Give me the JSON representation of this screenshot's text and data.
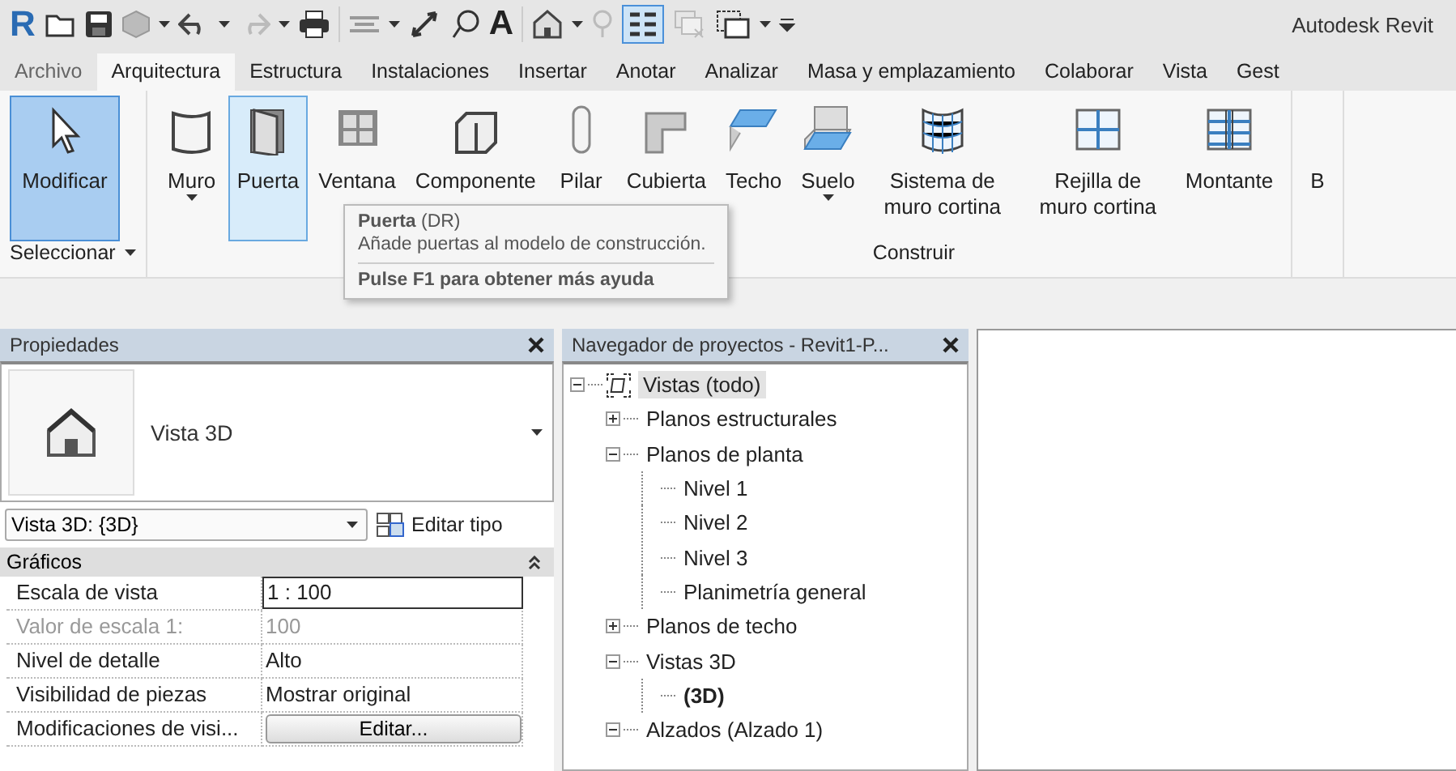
{
  "quick_access": {
    "logo": "R",
    "text_tool": "A",
    "title": "Autodesk Revit"
  },
  "tabs": [
    {
      "label": "Archivo",
      "kind": "app",
      "selected": false
    },
    {
      "label": "Arquitectura",
      "kind": "tab",
      "selected": true
    },
    {
      "label": "Estructura",
      "kind": "tab",
      "selected": false
    },
    {
      "label": "Instalaciones",
      "kind": "tab",
      "selected": false
    },
    {
      "label": "Insertar",
      "kind": "tab",
      "selected": false
    },
    {
      "label": "Anotar",
      "kind": "tab",
      "selected": false
    },
    {
      "label": "Analizar",
      "kind": "tab",
      "selected": false
    },
    {
      "label": "Masa y emplazamiento",
      "kind": "tab",
      "selected": false
    },
    {
      "label": "Colaborar",
      "kind": "tab",
      "selected": false
    },
    {
      "label": "Vista",
      "kind": "tab",
      "selected": false
    },
    {
      "label": "Gest",
      "kind": "tab",
      "selected": false
    }
  ],
  "ribbon": {
    "panels": [
      {
        "label": "Seleccionar",
        "dropdown": true,
        "tools": [
          {
            "label": "Modificar",
            "kind": "cursor",
            "selected": true,
            "hover": false,
            "dropdown": false
          }
        ]
      },
      {
        "label": "Construir",
        "dropdown": false,
        "tools": [
          {
            "label": "Muro",
            "kind": "wall",
            "selected": false,
            "hover": false,
            "dropdown": true
          },
          {
            "label": "Puerta",
            "kind": "door",
            "selected": false,
            "hover": true,
            "dropdown": false
          },
          {
            "label": "Ventana",
            "kind": "window",
            "selected": false,
            "hover": false,
            "dropdown": false
          },
          {
            "label": "Componente",
            "kind": "component",
            "selected": false,
            "hover": false,
            "dropdown": false
          },
          {
            "label": "Pilar",
            "kind": "column",
            "selected": false,
            "hover": false,
            "dropdown": false
          },
          {
            "label": "Cubierta",
            "kind": "roof",
            "selected": false,
            "hover": false,
            "dropdown": false
          },
          {
            "label": "Techo",
            "kind": "ceiling",
            "selected": false,
            "hover": false,
            "dropdown": false
          },
          {
            "label": "Suelo",
            "kind": "floor",
            "selected": false,
            "hover": false,
            "dropdown": true
          },
          {
            "label": "Sistema de muro cortina",
            "kind": "curtainsystem",
            "selected": false,
            "hover": false,
            "dropdown": false
          },
          {
            "label": "Rejilla de muro cortina",
            "kind": "curtaingrid",
            "selected": false,
            "hover": false,
            "dropdown": false
          },
          {
            "label": "Montante",
            "kind": "mullion",
            "selected": false,
            "hover": false,
            "dropdown": false
          }
        ]
      },
      {
        "tools": [
          {
            "label": "B",
            "kind": "none",
            "selected": false,
            "hover": false,
            "dropdown": false
          }
        ]
      }
    ]
  },
  "tooltip": {
    "title": "**Puerta** (DR)",
    "description": "Añade puertas al modelo de construcción.",
    "help": "Pulse F1 para obtener más ayuda"
  },
  "properties": {
    "title": "Propiedades",
    "type_name": "Vista 3D",
    "instance": "Vista 3D: {3D}",
    "edit_type": "Editar tipo",
    "section": "Gráficos",
    "rows": [
      {
        "label": "Escala de vista",
        "value": "1 : 100",
        "kind": "input",
        "disabled": false
      },
      {
        "label": "Valor de escala    1:",
        "value": "100",
        "kind": "text",
        "disabled": true
      },
      {
        "label": "Nivel de detalle",
        "value": "Alto",
        "kind": "text",
        "disabled": false
      },
      {
        "label": "Visibilidad de piezas",
        "value": "Mostrar original",
        "kind": "text",
        "disabled": false
      },
      {
        "label": "Modificaciones de visi...",
        "value": "Editar...",
        "kind": "button",
        "disabled": false
      }
    ]
  },
  "browser": {
    "title": "Navegador de proyectos - Revit1-P...",
    "tree": [
      {
        "label": "Vistas (todo)",
        "expanded": true,
        "selected": true,
        "current": false,
        "children": [
          {
            "label": "Planos estructurales",
            "expanded": false,
            "selected": false,
            "current": false
          },
          {
            "label": "Planos de planta",
            "expanded": true,
            "selected": false,
            "current": false,
            "children": [
              {
                "label": "Nivel 1",
                "selected": false,
                "current": false
              },
              {
                "label": "Nivel 2",
                "selected": false,
                "current": false
              },
              {
                "label": "Nivel 3",
                "selected": false,
                "current": false
              },
              {
                "label": "Planimetría general",
                "selected": false,
                "current": false
              }
            ]
          },
          {
            "label": "Planos de techo",
            "expanded": false,
            "selected": false,
            "current": false
          },
          {
            "label": "Vistas 3D",
            "expanded": true,
            "selected": false,
            "current": false,
            "children": [
              {
                "label": "(3D)",
                "selected": false,
                "current": true
              }
            ]
          },
          {
            "label": "Alzados (Alzado 1)",
            "expanded": true,
            "selected": false,
            "current": false
          }
        ]
      }
    ]
  }
}
